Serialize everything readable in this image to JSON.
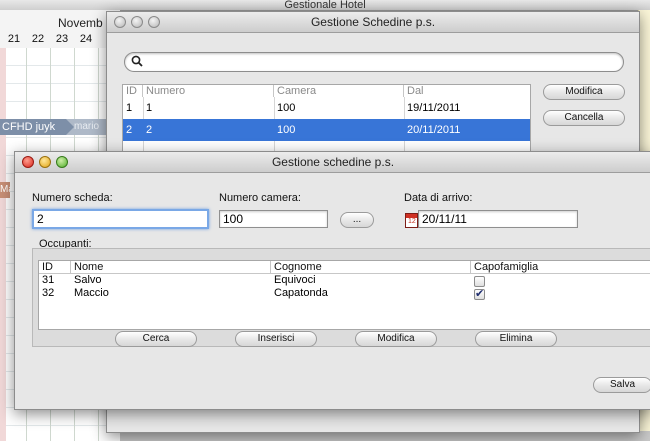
{
  "app": {
    "title": "Gestionale Hotel"
  },
  "calendar": {
    "month": "Novemb",
    "days": [
      "21",
      "22",
      "23",
      "24"
    ],
    "booking_label": "CFHD juyk",
    "booking_label_2": "mario",
    "mac_label": "Mac"
  },
  "schede_window": {
    "title": "Gestione Schedine p.s.",
    "search": {
      "value": "",
      "placeholder": ""
    },
    "table": {
      "columns": [
        "ID",
        "Numero",
        "Camera",
        "Dal"
      ],
      "rows": [
        {
          "id": "1",
          "numero": "1",
          "camera": "100",
          "dal": "19/11/2011",
          "selected": false
        },
        {
          "id": "2",
          "numero": "2",
          "camera": "100",
          "dal": "20/11/2011",
          "selected": true
        }
      ]
    },
    "buttons": {
      "modifica": "Modifica",
      "cancella": "Cancella"
    }
  },
  "scheda_window": {
    "title": "Gestione schedine p.s.",
    "fields": {
      "numero_scheda_label": "Numero scheda:",
      "numero_scheda_value": "2",
      "numero_camera_label": "Numero camera:",
      "numero_camera_value": "100",
      "browse_button": "...",
      "data_arrivo_label": "Data di arrivo:",
      "data_arrivo_value": "20/11/11",
      "calendar_icon_day": "12"
    },
    "occupanti": {
      "label": "Occupanti:",
      "columns": [
        "ID",
        "Nome",
        "Cognome",
        "Capofamiglia"
      ],
      "rows": [
        {
          "id": "31",
          "nome": "Salvo",
          "cognome": "Equivoci",
          "capofamiglia": false
        },
        {
          "id": "32",
          "nome": "Maccio",
          "cognome": "Capatonda",
          "capofamiglia": true
        }
      ]
    },
    "buttons": {
      "cerca": "Cerca",
      "inserisci": "Inserisci",
      "modifica": "Modifica",
      "elimina": "Elimina",
      "salva": "Salva"
    }
  },
  "colors": {
    "selection": "#3875d7",
    "booking": "#7d8fa8",
    "focus": "#7aa8e6"
  }
}
